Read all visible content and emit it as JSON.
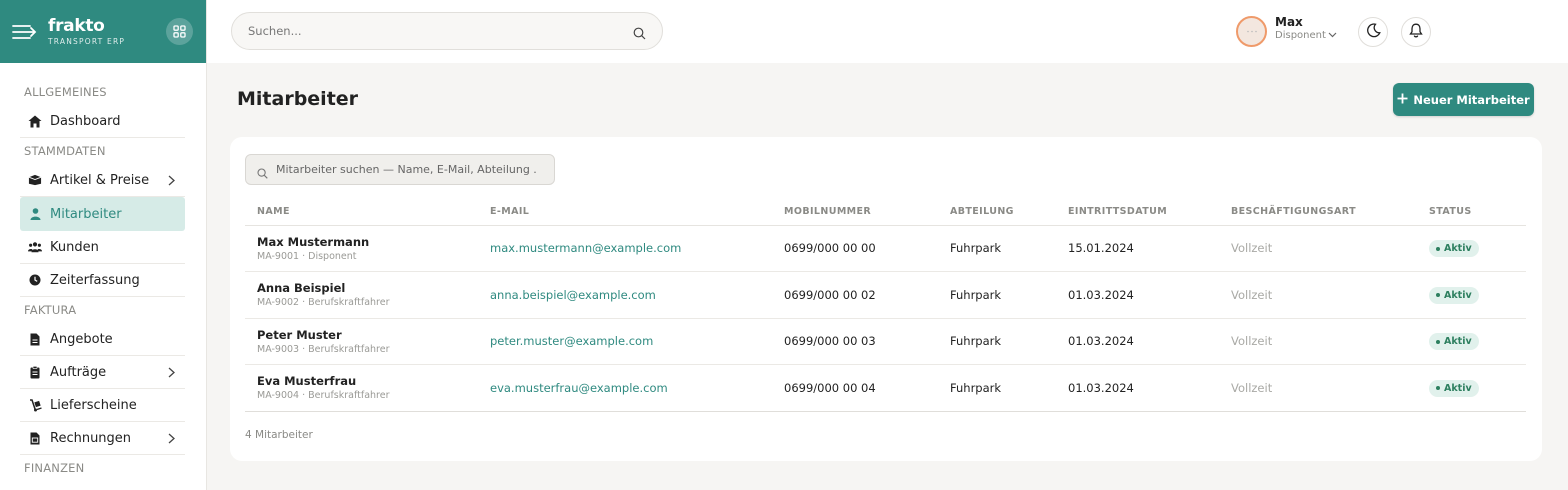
{
  "brand": {
    "name": "frakto",
    "tagline": "TRANSPORT ERP"
  },
  "header": {
    "search_placeholder": "Suchen...",
    "user": {
      "name": "Max",
      "role": "Disponent"
    }
  },
  "sidebar": {
    "sections": [
      {
        "title": "ALLGEMEINES",
        "items": [
          {
            "label": "Dashboard",
            "icon": "home-icon"
          }
        ]
      },
      {
        "title": "STAMMDATEN",
        "items": [
          {
            "label": "Artikel & Preise",
            "icon": "box-icon",
            "chevron": true
          },
          {
            "label": "Mitarbeiter",
            "icon": "user-icon",
            "active": true
          },
          {
            "label": "Kunden",
            "icon": "users-icon"
          },
          {
            "label": "Zeiterfassung",
            "icon": "clock-icon"
          }
        ]
      },
      {
        "title": "FAKTURA",
        "items": [
          {
            "label": "Angebote",
            "icon": "document-icon"
          },
          {
            "label": "Aufträge",
            "icon": "clipboard-icon",
            "chevron": true
          },
          {
            "label": "Lieferscheine",
            "icon": "dolly-icon"
          },
          {
            "label": "Rechnungen",
            "icon": "invoice-icon",
            "chevron": true
          }
        ]
      },
      {
        "title": "FINANZEN",
        "items": []
      }
    ]
  },
  "main": {
    "title": "Mitarbeiter",
    "new_button": "Neuer Mitarbeiter",
    "table_search_placeholder": "Mitarbeiter suchen — Name, E-Mail, Abteilung ...",
    "columns": [
      "NAME",
      "E-MAIL",
      "MOBILNUMMER",
      "ABTEILUNG",
      "EINTRITTSDATUM",
      "BESCHÄFTIGUNGSART",
      "STATUS"
    ],
    "rows": [
      {
        "name": "Max Mustermann",
        "sub": "MA-9001 · Disponent",
        "email": "max.mustermann@example.com",
        "phone": "0699/000 00 00",
        "dept": "Fuhrpark",
        "date": "15.01.2024",
        "type": "Vollzeit",
        "status": "Aktiv"
      },
      {
        "name": "Anna Beispiel",
        "sub": "MA-9002 · Berufskraftfahrer",
        "email": "anna.beispiel@example.com",
        "phone": "0699/000 00 02",
        "dept": "Fuhrpark",
        "date": "01.03.2024",
        "type": "Vollzeit",
        "status": "Aktiv"
      },
      {
        "name": "Peter Muster",
        "sub": "MA-9003 · Berufskraftfahrer",
        "email": "peter.muster@example.com",
        "phone": "0699/000 00 03",
        "dept": "Fuhrpark",
        "date": "01.03.2024",
        "type": "Vollzeit",
        "status": "Aktiv"
      },
      {
        "name": "Eva Musterfrau",
        "sub": "MA-9004 · Berufskraftfahrer",
        "email": "eva.musterfrau@example.com",
        "phone": "0699/000 00 04",
        "dept": "Fuhrpark",
        "date": "01.03.2024",
        "type": "Vollzeit",
        "status": "Aktiv"
      }
    ],
    "count_label": "4 Mitarbeiter"
  },
  "colors": {
    "brand": "#2f8a80",
    "active_bg": "#d6ebe7",
    "badge_bg": "#e1f1ec",
    "badge_fg": "#2d7f5f",
    "avatar_ring": "#ef9a6a"
  }
}
